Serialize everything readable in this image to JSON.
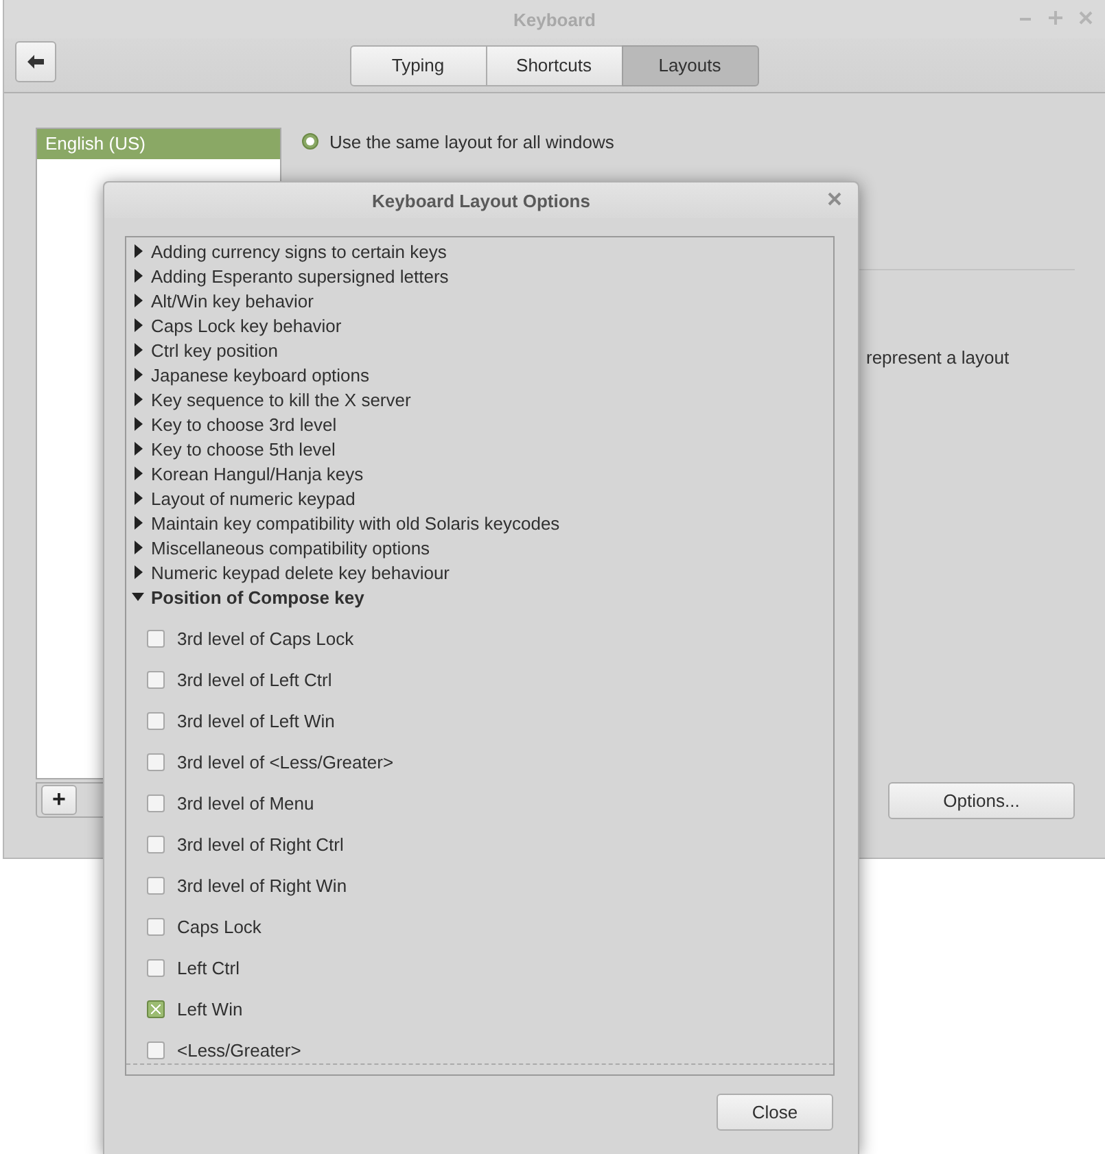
{
  "window": {
    "title": "Keyboard"
  },
  "tabs": [
    {
      "label": "Typing",
      "selected": false
    },
    {
      "label": "Shortcuts",
      "selected": false
    },
    {
      "label": "Layouts",
      "selected": true
    }
  ],
  "layouts": {
    "items": [
      {
        "label": "English (US)",
        "selected": true
      }
    ],
    "add_button": "+"
  },
  "layout_mode": [
    {
      "label": "Use the same layout for all windows",
      "selected": true
    }
  ],
  "hint_fragment": "represent a layout",
  "options_button": "Options...",
  "dialog": {
    "title": "Keyboard Layout Options",
    "groups": [
      {
        "label": "Adding currency signs to certain keys",
        "expanded": false
      },
      {
        "label": "Adding Esperanto supersigned letters",
        "expanded": false
      },
      {
        "label": "Alt/Win key behavior",
        "expanded": false
      },
      {
        "label": "Caps Lock key behavior",
        "expanded": false
      },
      {
        "label": "Ctrl key position",
        "expanded": false
      },
      {
        "label": "Japanese keyboard options",
        "expanded": false
      },
      {
        "label": "Key sequence to kill the X server",
        "expanded": false
      },
      {
        "label": "Key to choose 3rd level",
        "expanded": false
      },
      {
        "label": "Key to choose 5th level",
        "expanded": false
      },
      {
        "label": "Korean Hangul/Hanja keys",
        "expanded": false
      },
      {
        "label": "Layout of numeric keypad",
        "expanded": false
      },
      {
        "label": "Maintain key compatibility with old Solaris keycodes",
        "expanded": false
      },
      {
        "label": "Miscellaneous compatibility options",
        "expanded": false
      },
      {
        "label": "Numeric keypad delete key behaviour",
        "expanded": false
      },
      {
        "label": "Position of Compose key",
        "expanded": true,
        "children": [
          {
            "label": "3rd level of Caps Lock",
            "checked": false
          },
          {
            "label": "3rd level of Left Ctrl",
            "checked": false
          },
          {
            "label": "3rd level of Left Win",
            "checked": false
          },
          {
            "label": "3rd level of <Less/Greater>",
            "checked": false
          },
          {
            "label": "3rd level of Menu",
            "checked": false
          },
          {
            "label": "3rd level of Right Ctrl",
            "checked": false
          },
          {
            "label": "3rd level of Right Win",
            "checked": false
          },
          {
            "label": "Caps Lock",
            "checked": false
          },
          {
            "label": "Left Ctrl",
            "checked": false
          },
          {
            "label": "Left Win",
            "checked": true
          },
          {
            "label": "<Less/Greater>",
            "checked": false
          }
        ]
      }
    ],
    "close_button": "Close"
  }
}
